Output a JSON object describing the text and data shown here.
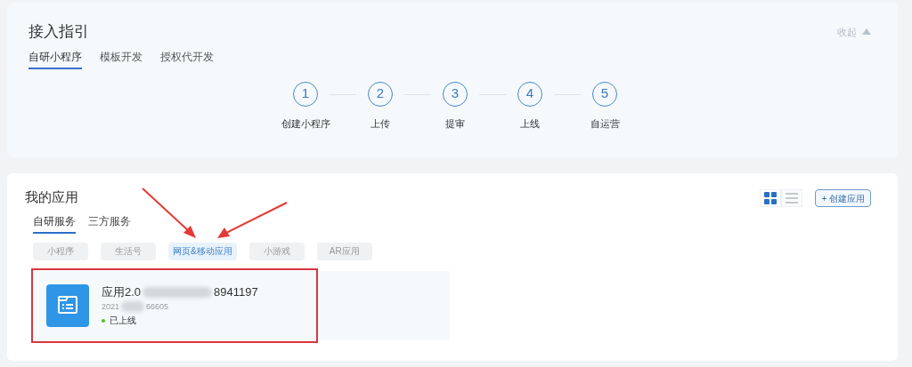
{
  "guide": {
    "title": "接入指引",
    "collapse": "收起",
    "tabs": [
      {
        "label": "自研小程序",
        "selected": true
      },
      {
        "label": "模板开发",
        "selected": false
      },
      {
        "label": "授权代开发",
        "selected": false
      }
    ],
    "steps": [
      {
        "number": "1",
        "label": "创建小程序"
      },
      {
        "number": "2",
        "label": "上传"
      },
      {
        "number": "3",
        "label": "提审"
      },
      {
        "number": "4",
        "label": "上线"
      },
      {
        "number": "5",
        "label": "自运营"
      }
    ]
  },
  "apps": {
    "title": "我的应用",
    "views": [
      {
        "kind": "grid",
        "selected": true
      },
      {
        "kind": "list",
        "selected": false
      }
    ],
    "create_button": "+ 创建应用",
    "tabs": [
      {
        "label": "自研服务",
        "selected": true
      },
      {
        "label": "三方服务",
        "selected": false
      }
    ],
    "filters": [
      {
        "label": "小程序",
        "selected": false
      },
      {
        "label": "生活号",
        "selected": false
      },
      {
        "label": "网页&移动应用",
        "selected": true
      },
      {
        "label": "小游戏",
        "selected": false
      },
      {
        "label": "AR应用",
        "selected": false
      }
    ],
    "items": [
      {
        "name_parts": [
          "应用2.0",
          "8941197"
        ],
        "id_parts": [
          "2021",
          "66605"
        ],
        "status": "已上线",
        "online": true,
        "highlighted": true
      }
    ]
  }
}
